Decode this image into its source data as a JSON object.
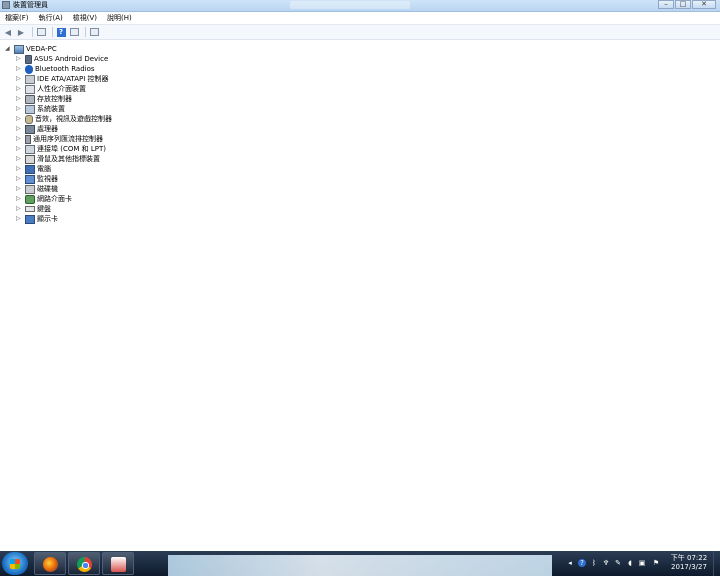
{
  "window": {
    "title": "裝置管理員"
  },
  "menu": [
    "檔案(F)",
    "執行(A)",
    "檢視(V)",
    "說明(H)"
  ],
  "window_buttons": {
    "minimize": "–",
    "maximize": "□",
    "close": "✕"
  },
  "tree": {
    "root": "VEDA-PC",
    "items": [
      "ASUS Android Device",
      "Bluetooth Radios",
      "IDE ATA/ATAPI 控制器",
      "人性化介面裝置",
      "存放控制器",
      "系統裝置",
      "音效，視訊及遊戲控制器",
      "處理器",
      "通用序列匯流排控制器",
      "連接埠 (COM 和 LPT)",
      "滑鼠及其他指標裝置",
      "電腦",
      "監視器",
      "磁碟機",
      "網路介面卡",
      "鍵盤",
      "顯示卡"
    ]
  },
  "taskbar": {
    "clock_period_time": "下午 07:22",
    "clock_date": "2017/3/27"
  }
}
